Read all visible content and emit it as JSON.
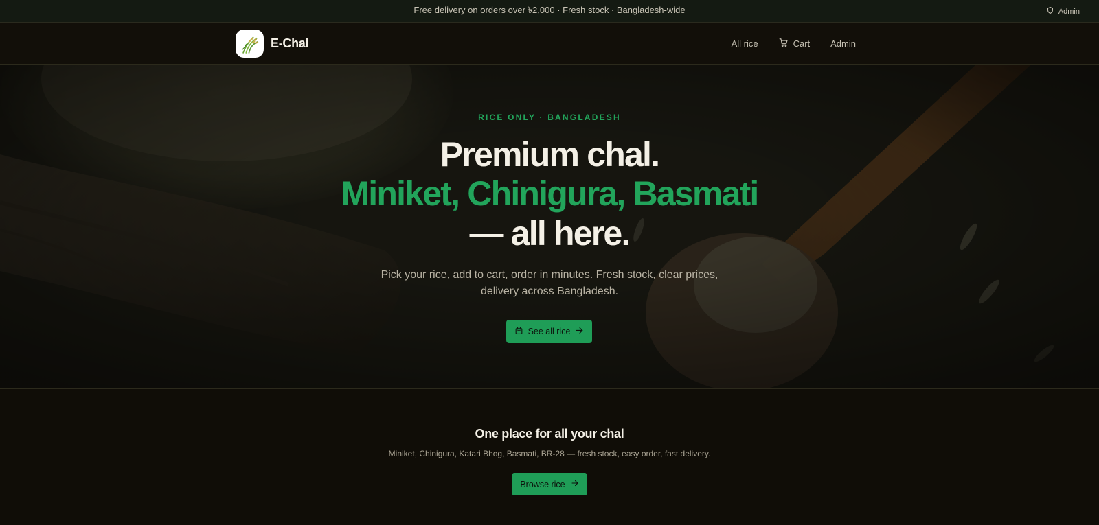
{
  "topbar": {
    "announcement": "Free delivery on orders over ৳2,000 · Fresh stock · Bangladesh-wide",
    "admin_label": "Admin",
    "admin_icon": "shield-icon"
  },
  "navbar": {
    "brand_name": "E-Chal",
    "logo_icon": "rice-stalk-logo",
    "links": [
      {
        "label": "All rice",
        "icon": ""
      },
      {
        "label": "Cart",
        "icon": "cart-icon"
      },
      {
        "label": "Admin",
        "icon": ""
      }
    ]
  },
  "hero": {
    "eyebrow": "RICE ONLY · BANGLADESH",
    "headline_line1": "Premium chal.",
    "headline_line2": "Miniket, Chinigura, Basmati",
    "headline_line3": "— all here.",
    "subtext": "Pick your rice, add to cart, order in minutes. Fresh stock, clear prices, delivery across Bangladesh.",
    "cta_label": "See all rice",
    "cta_icon": "shopping-bag-icon",
    "cta_arrow": "arrow-right-icon"
  },
  "feature": {
    "title": "One place for all your chal",
    "subtitle": "Miniket, Chinigura, Katari Bhog, Basmati, BR-28 — fresh stock, easy order, fast delivery.",
    "button_label": "Browse rice",
    "button_arrow": "arrow-right-icon"
  },
  "colors": {
    "accent": "#22a45b",
    "button": "#1f9d57",
    "background": "#0f0c07",
    "text_primary": "#f4f0e6",
    "text_muted": "#b9b3a4"
  }
}
